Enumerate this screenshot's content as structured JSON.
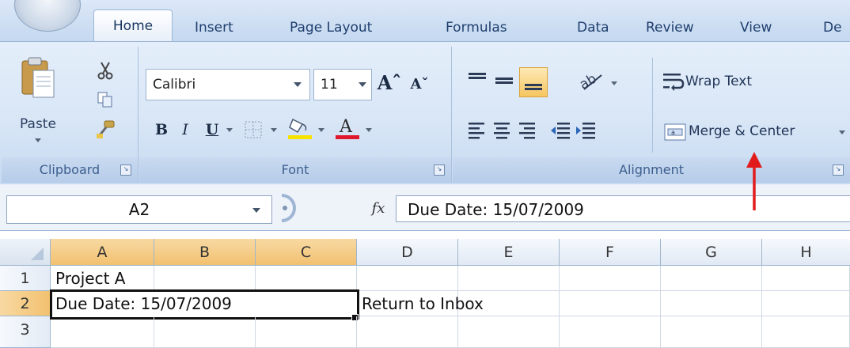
{
  "tabs": [
    "Home",
    "Insert",
    "Page Layout",
    "Formulas",
    "Data",
    "Review",
    "View",
    "De"
  ],
  "clipboard": {
    "paste_label": "Paste",
    "group_label": "Clipboard"
  },
  "font": {
    "name": "Calibri",
    "size": "11",
    "group_label": "Font"
  },
  "alignment": {
    "wrap_text_label": "Wrap Text",
    "merge_center_label": "Merge & Center",
    "group_label": "Alignment"
  },
  "formula_bar": {
    "name_box": "A2",
    "fx_label": "fx",
    "content": "Due Date: 15/07/2009"
  },
  "sheet": {
    "columns": [
      "A",
      "B",
      "C",
      "D",
      "E",
      "F",
      "G",
      "H"
    ],
    "rows": [
      "1",
      "2",
      "3"
    ],
    "cells": {
      "A1": "Project A",
      "A2": "Due Date: 15/07/2009",
      "D2": "Return to Inbox"
    }
  },
  "colors": {
    "accent": "#f2c16f",
    "annotation_arrow": "#e11b1b",
    "highlight": "#f6e400",
    "font_color": "#e0182d"
  },
  "icons": [
    "paste-icon",
    "cut-icon",
    "copy-icon",
    "format-painter-icon",
    "fill-color-icon",
    "font-color-icon",
    "borders-icon",
    "wrap-text-icon",
    "merge-center-icon",
    "fx-icon",
    "red-arrow-icon"
  ]
}
